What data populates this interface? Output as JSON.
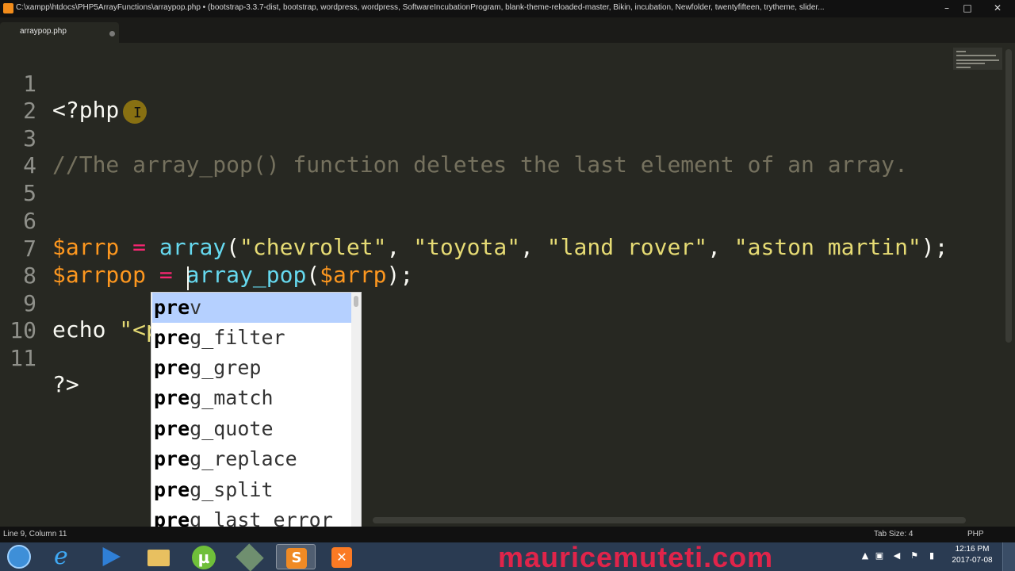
{
  "window": {
    "title": "C:\\xampp\\htdocs\\PHP5ArrayFunctions\\arraypop.php • (bootstrap-3.3.7-dist, bootstrap, wordpress, wordpress, SoftwareIncubationProgram, blank-theme-reloaded-master, Bikin, incubation, Newfolder, twentyfifteen, trytheme, slider..."
  },
  "tab": {
    "label": "arraypop.php"
  },
  "editor": {
    "lines": [
      {
        "n": "1",
        "code": "<?php"
      },
      {
        "n": "2",
        "code": ""
      },
      {
        "n": "3",
        "comment": "//The array_pop() function deletes the last element of an array."
      },
      {
        "n": "4",
        "code": ""
      },
      {
        "n": "5",
        "code": ""
      },
      {
        "n": "6",
        "var": "$arrp",
        "eq": " = ",
        "fn": "array",
        "open": "(",
        "s1": "\"chevrolet\"",
        "c1": ", ",
        "s2": "\"toyota\"",
        "c2": ", ",
        "s3": "\"land rover\"",
        "c3": ", ",
        "s4": "\"aston martin\"",
        "close": ");"
      },
      {
        "n": "7",
        "var": "$arrpop",
        "eq": " = ",
        "fn": "array_pop",
        "open": "(",
        "arg": "$arrp",
        "close": ");"
      },
      {
        "n": "8",
        "code": ""
      },
      {
        "n": "9",
        "kw": "echo ",
        "str": "\"<pre\""
      },
      {
        "n": "10",
        "code": ""
      },
      {
        "n": "11",
        "code": "?>"
      }
    ]
  },
  "autocomplete": {
    "typed": "pre",
    "items": [
      {
        "match": "pre",
        "rest": "v"
      },
      {
        "match": "pre",
        "rest": "g_filter"
      },
      {
        "match": "pre",
        "rest": "g_grep"
      },
      {
        "match": "pre",
        "rest": "g_match"
      },
      {
        "match": "pre",
        "rest": "g_quote"
      },
      {
        "match": "pre",
        "rest": "g_replace"
      },
      {
        "match": "pre",
        "rest": "g_split"
      },
      {
        "match": "pre",
        "rest": "g_last_error"
      }
    ],
    "selected_index": 0
  },
  "status": {
    "position": "Line 9, Column 11",
    "tab_size": "Tab Size: 4",
    "syntax": "PHP"
  },
  "taskbar": {
    "watermark": "mauricemuteti.com",
    "time": "12:16 PM",
    "date": "2017-07-08"
  },
  "colors": {
    "editor_bg": "#272822",
    "comment": "#75715e",
    "variable": "#fd971f",
    "operator": "#f92672",
    "function": "#66d9ef",
    "string": "#e6db74",
    "autocomplete_selected": "#b5d0ff",
    "watermark": "#e0244a"
  },
  "icons": [
    "start-orb-icon",
    "internet-explorer-icon",
    "media-player-icon",
    "file-explorer-icon",
    "utorrent-icon",
    "tool-icon",
    "sublime-text-icon",
    "xampp-icon"
  ]
}
